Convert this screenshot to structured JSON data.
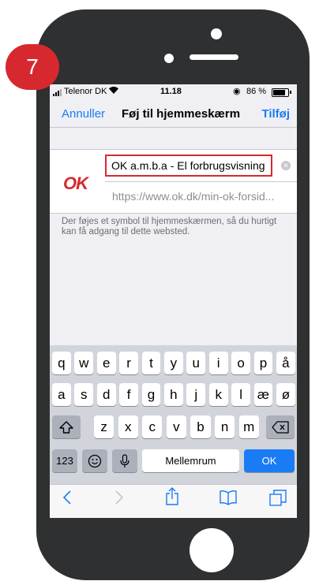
{
  "step": {
    "number": "7"
  },
  "status_bar": {
    "carrier": "Telenor DK",
    "time": "11.18",
    "battery_percent": "86 %",
    "battery_level": 0.86
  },
  "nav": {
    "cancel_label": "Annuller",
    "title": "Føj til hjemmeskærm",
    "add_label": "Tilføj"
  },
  "bookmark": {
    "logo_text": "OK",
    "name_value": "OK a.m.b.a - El forbrugsvisning",
    "url": "https://www.ok.dk/min-ok-forsid..."
  },
  "description": "Der føjes et symbol til hjemmeskærmen, så du hurtigt kan få adgang til dette websted.",
  "keyboard": {
    "row1": [
      "q",
      "w",
      "e",
      "r",
      "t",
      "y",
      "u",
      "i",
      "o",
      "p",
      "å"
    ],
    "row2": [
      "a",
      "s",
      "d",
      "f",
      "g",
      "h",
      "j",
      "k",
      "l",
      "æ",
      "ø"
    ],
    "row3": [
      "z",
      "x",
      "c",
      "v",
      "b",
      "n",
      "m"
    ],
    "numbers_label": "123",
    "space_label": "Mellemrum",
    "return_label": "OK"
  },
  "colors": {
    "accent": "#1a7cf5",
    "brand_red": "#d7282f",
    "phone_body": "#2f3031"
  },
  "icons": {
    "wifi": "wifi-icon",
    "emoji": "emoji-icon",
    "mic": "microphone-icon",
    "shift": "shift-icon",
    "backspace": "backspace-icon",
    "back": "chevron-left-icon",
    "forward": "chevron-right-icon",
    "share": "share-icon",
    "bookmarks": "book-icon",
    "tabs": "tabs-icon"
  }
}
